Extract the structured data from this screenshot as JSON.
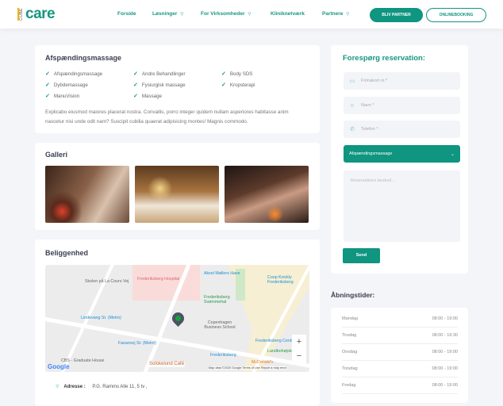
{
  "header": {
    "logo_small": "CUBE",
    "logo_main": "care",
    "nav": [
      {
        "label": "Forside",
        "dropdown": false
      },
      {
        "label": "Løsninger",
        "dropdown": true
      },
      {
        "label": "For Virksomheder",
        "dropdown": true
      },
      {
        "label": "Kliniknetværk",
        "dropdown": false
      },
      {
        "label": "Partnere",
        "dropdown": true
      }
    ],
    "partner_button": "BLIV PARTNER",
    "booking_button": "ONLINEBOOKING"
  },
  "treatment": {
    "title": "Afspændingsmassage",
    "features": [
      "Afspændingsmassage",
      "Andre Behandlinger",
      "Body SDS",
      "Dybdemassage",
      "Fysiurgisk massage",
      "Kropsterapi",
      "ManuVision",
      "Massage"
    ],
    "description": "Explicabo eiusmod maiores placerat nostra. Convallis, porro integer quidem nullam asperiores habitasse anim nascetur nisi unde odit nam? Suscipit cubilia quaerat adipisicing montes! Magnis commodo."
  },
  "gallery": {
    "title": "Galleri"
  },
  "location": {
    "title": "Beliggenhed",
    "address_label": "Adresse :",
    "address_value": "P.G. Ramms Alle 11, 5 tv ,",
    "map_labels": [
      "Skolen på La Cours Vej",
      "Frederiksberg Hospital",
      "Aksel Møllers Have",
      "Coop Kvickly Frederiksberg",
      "Frederiksberg Svømmehal",
      "Lindevang St. (Metro)",
      "Copenhagen Business School",
      "Fasanvej St. (Metro)",
      "Frederiksberg Centret",
      "Frederiksberg",
      "Landbohøjskolen",
      "CBS - Graduate House",
      "McDonald's",
      "Solokelund Café"
    ],
    "map_footer": "Map data ©2020 Google   Terms of Use   Report a map error",
    "google": "Google",
    "zoom_in": "+",
    "zoom_out": "−"
  },
  "reservation": {
    "title": "Forespørg reservation:",
    "company_card_placeholder": "Firmakort nr.*",
    "name_placeholder": "Navn *",
    "phone_placeholder": "Telefon *",
    "treatment_selected": "Afspændingsmassage",
    "message_placeholder": "Reservations besked...",
    "send": "Send"
  },
  "hours": {
    "title": "Åbningstider:",
    "days": [
      {
        "day": "Mandag",
        "time": "08:00 - 19:00"
      },
      {
        "day": "Tirsdag",
        "time": "08:00 - 19:30"
      },
      {
        "day": "Onsdag",
        "time": "08:00 - 19:00"
      },
      {
        "day": "Torsdag",
        "time": "08:00 - 19:00"
      },
      {
        "day": "Fredag",
        "time": "08:00 - 19:00"
      }
    ]
  }
}
